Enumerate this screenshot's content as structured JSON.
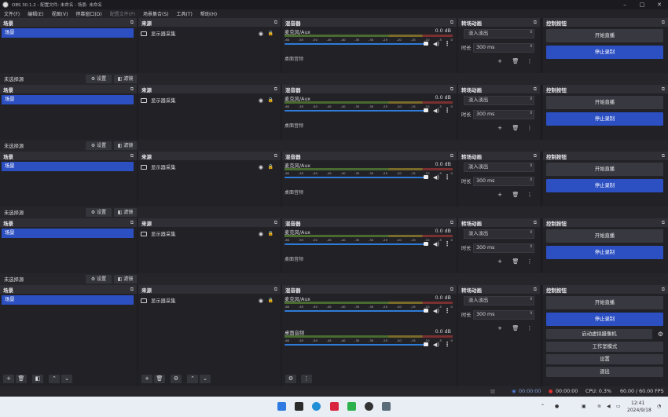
{
  "window": {
    "title": "OBS 30.1.2 - 配置文件: 未命名 - 场景: 未命名"
  },
  "menu": [
    "文件(F)",
    "编辑(E)",
    "视图(V)",
    "停靠窗口(D)",
    "配置文件(P)",
    "场景集合(S)",
    "工具(T)",
    "帮助(H)"
  ],
  "docks": {
    "scenes_title": "场景",
    "sources_title": "来源",
    "mixer_title": "混音器",
    "transitions_title": "转场动画",
    "controls_title": "控制按钮"
  },
  "scene_item": "场景",
  "source_item": "显示器采集",
  "mixer": {
    "tracks": [
      {
        "name": "麦克风/Aux",
        "db": "0.0 dB"
      },
      {
        "name": "桌面音频",
        "db": "0.0 dB"
      }
    ],
    "scale": [
      "-60",
      "-55",
      "-50",
      "-45",
      "-40",
      "-35",
      "-30",
      "-25",
      "-20",
      "-15",
      "-10",
      "-5",
      "0"
    ]
  },
  "transitions": {
    "type": "淡入淡出",
    "duration_label": "时长",
    "duration": "300 ms"
  },
  "controls": {
    "start_stream": "开始直播",
    "stop_record": "停止录制",
    "virtual_cam": "启动虚拟摄像机",
    "studio_mode": "工作室模式",
    "settings": "设置",
    "exit": "退出"
  },
  "source_toolbar": {
    "no_source": "未选择源",
    "props": "设置",
    "filters": "滤镜"
  },
  "status": {
    "stream_time": "00:00:00",
    "record_time": "00:00:00",
    "cpu": "CPU: 0.3%",
    "fps": "60.00 / 60.00 FPS"
  },
  "taskbar": {
    "time": "12:41",
    "date": "2024/9/18"
  }
}
